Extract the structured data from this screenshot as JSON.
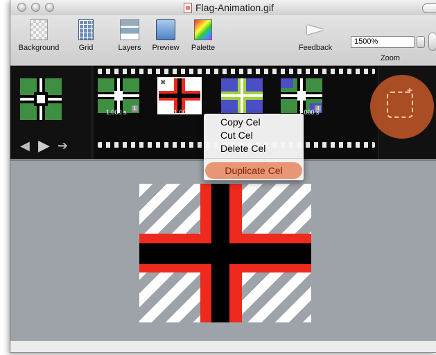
{
  "window": {
    "title": "Flag-Animation.gif"
  },
  "toolbar": {
    "background_label": "Background",
    "grid_label": "Grid",
    "layers_label": "Layers",
    "preview_label": "Preview",
    "palette_label": "Palette",
    "feedback_label": "Feedback",
    "zoom_label": "Zoom",
    "zoom_value": "1500%"
  },
  "frames": [
    {
      "duration": "1.000 s",
      "badge": "1"
    },
    {
      "duration": "1.000 s",
      "badge": ""
    },
    {
      "duration": "",
      "badge": ""
    },
    {
      "duration": "1.000 s",
      "badge": "4"
    }
  ],
  "context_menu": {
    "items": [
      "Copy Cel",
      "Cut Cel",
      "Delete Cel"
    ],
    "highlighted": "Duplicate Cel"
  },
  "colors": {
    "accent": "#e8865f",
    "flag_red": "#ee2a1e",
    "flag_green": "#3f8f43",
    "flag_blue": "#4a4fc4"
  }
}
